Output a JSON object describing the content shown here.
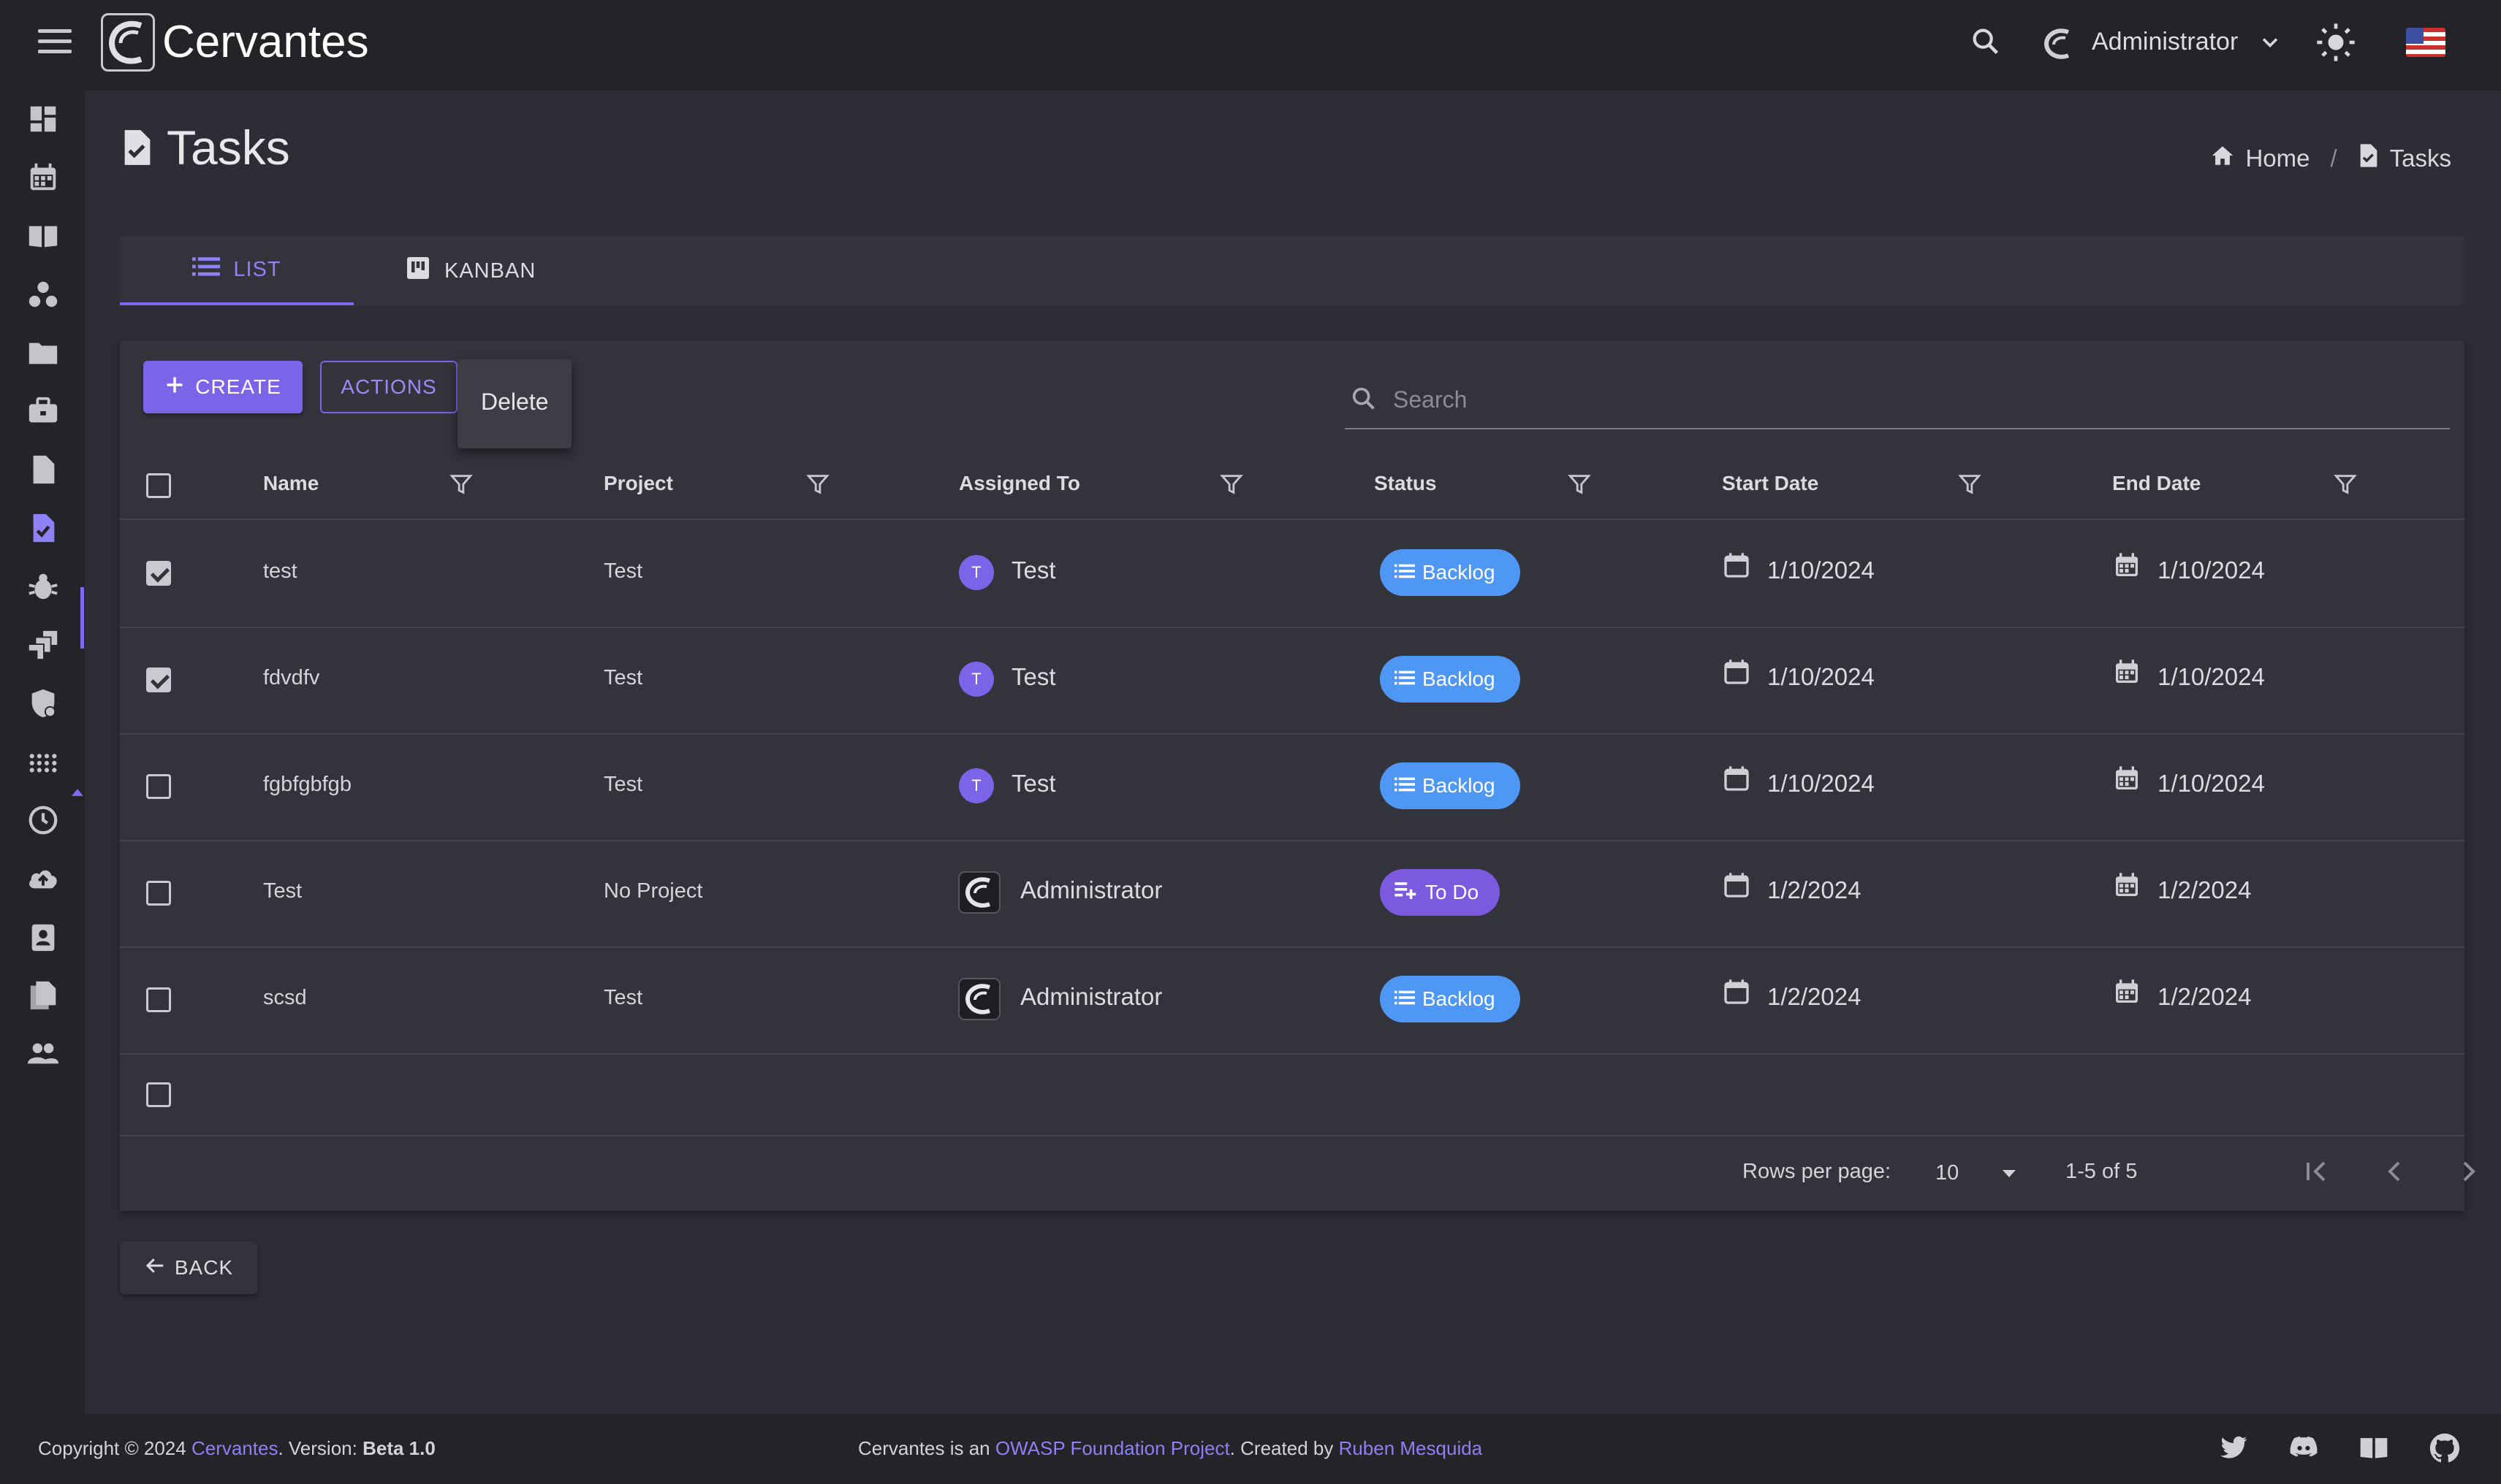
{
  "app": {
    "name": "Cervantes"
  },
  "topbar": {
    "user_name": "Administrator"
  },
  "page": {
    "title": "Tasks"
  },
  "breadcrumb": {
    "home": "Home",
    "separator": "/",
    "current": "Tasks"
  },
  "tabs": {
    "list": "LIST",
    "kanban": "KANBAN"
  },
  "toolbar": {
    "create_label": "CREATE",
    "actions_label": "ACTIONS",
    "delete_label": "Delete"
  },
  "search": {
    "placeholder": "Search"
  },
  "table": {
    "columns": [
      "Name",
      "Project",
      "Assigned To",
      "Status",
      "Start Date",
      "End Date"
    ],
    "rows": [
      {
        "checked": true,
        "name": "test",
        "project": "Test",
        "assigned": "Test",
        "avatar": "T",
        "status": "Backlog",
        "start": "1/10/2024",
        "end": "1/10/2024"
      },
      {
        "checked": true,
        "name": "fdvdfv",
        "project": "Test",
        "assigned": "Test",
        "avatar": "T",
        "status": "Backlog",
        "start": "1/10/2024",
        "end": "1/10/2024"
      },
      {
        "checked": false,
        "name": "fgbfgbfgb",
        "project": "Test",
        "assigned": "Test",
        "avatar": "T",
        "status": "Backlog",
        "start": "1/10/2024",
        "end": "1/10/2024"
      },
      {
        "checked": false,
        "name": "Test",
        "project": "No Project",
        "assigned": "Administrator",
        "avatar": "",
        "status": "To Do",
        "start": "1/2/2024",
        "end": "1/2/2024"
      },
      {
        "checked": false,
        "name": "scsd",
        "project": "Test",
        "assigned": "Administrator",
        "avatar": "",
        "status": "Backlog",
        "start": "1/2/2024",
        "end": "1/2/2024"
      }
    ]
  },
  "pagination": {
    "rows_per_page_label": "Rows per page:",
    "rows_per_page": "10",
    "range": "1-5 of 5"
  },
  "back": {
    "label": "BACK"
  },
  "footer": {
    "copyright_prefix": "Copyright © 2024 ",
    "copyright_link": "Cervantes",
    "version_prefix": ". Version: ",
    "version": "Beta 1.0",
    "center_prefix": "Cervantes is an ",
    "owasp_link": "OWASP Foundation Project",
    "center_mid": ". Created by ",
    "author_link": "Ruben Mesquida"
  },
  "colors": {
    "accent": "#7b64e8",
    "backlog": "#4f97f4",
    "todo": "#7b5ae0",
    "background": "#2d2d36",
    "surface": "#33333c",
    "bar": "#232328"
  },
  "icons": {
    "sidebar": [
      "dashboard-icon",
      "calendar-icon",
      "book-icon",
      "bubble-chart-icon",
      "folder-icon",
      "briefcase-icon",
      "document-icon",
      "task-icon",
      "bug-icon",
      "jira-icon",
      "shield-icon",
      "apps-icon",
      "history-icon",
      "cloud-upload-icon",
      "contact-icon",
      "files-icon",
      "people-icon"
    ],
    "footer": [
      "twitter-icon",
      "discord-icon",
      "docs-icon",
      "github-icon"
    ]
  }
}
